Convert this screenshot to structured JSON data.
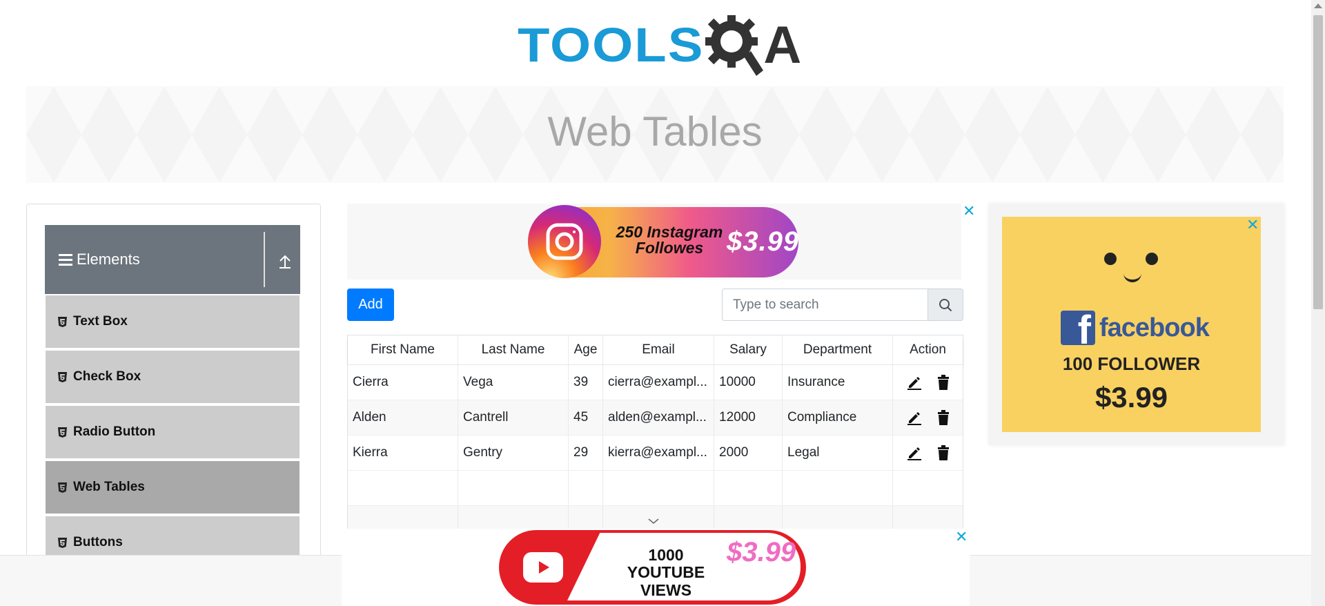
{
  "header": {
    "logo_tools": "TOOLS",
    "logo_a": "A"
  },
  "banner": {
    "title": "Web Tables"
  },
  "sidebar": {
    "group_title": "Elements",
    "items": [
      {
        "label": "Text Box",
        "active": false
      },
      {
        "label": "Check Box",
        "active": false
      },
      {
        "label": "Radio Button",
        "active": false
      },
      {
        "label": "Web Tables",
        "active": true
      },
      {
        "label": "Buttons",
        "active": false
      }
    ]
  },
  "ads": {
    "instagram": {
      "line1": "250 Instagram",
      "line2": "Followes",
      "price": "$3.99"
    },
    "facebook": {
      "brand": "facebook",
      "line1": "100 FOLLOWER",
      "price": "$3.99"
    },
    "youtube": {
      "line1": "1000",
      "line2": "YOUTUBE VIEWS",
      "price": "$3.99"
    },
    "close_glyph": "✕"
  },
  "controls": {
    "add_label": "Add",
    "search_placeholder": "Type to search"
  },
  "table": {
    "headers": [
      "First Name",
      "Last Name",
      "Age",
      "Email",
      "Salary",
      "Department",
      "Action"
    ],
    "rows": [
      [
        "Cierra",
        "Vega",
        "39",
        "cierra@exampl...",
        "10000",
        "Insurance"
      ],
      [
        "Alden",
        "Cantrell",
        "45",
        "alden@exampl...",
        "12000",
        "Compliance"
      ],
      [
        "Kierra",
        "Gentry",
        "29",
        "kierra@exampl...",
        "2000",
        "Legal"
      ]
    ]
  },
  "colors": {
    "primary": "#007bff",
    "sidebar_header": "#6c757d",
    "menu_item": "#cccccc",
    "menu_active": "#a9a9a9",
    "logo_blue": "#1a9ad6",
    "ad_close": "#0da8d8"
  }
}
